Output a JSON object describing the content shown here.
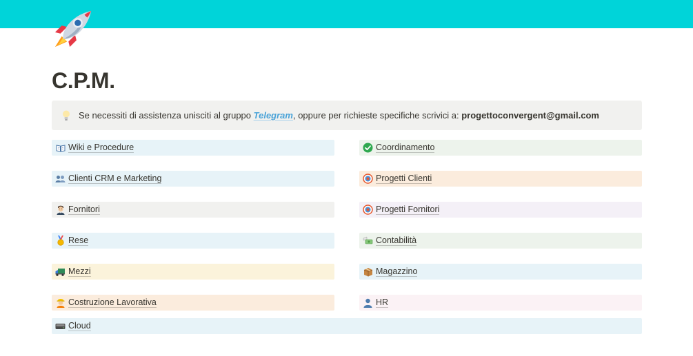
{
  "colors": {
    "cover": "#00d4d9",
    "callout_bg": "#f1f1ef",
    "link": "#4aa3d8",
    "blue_bg": "#e7f3f8",
    "green_bg": "#edf3ec",
    "orange_bg": "#fbecdd",
    "gray_bg": "#f1f1ef",
    "purple_bg": "#f4f0f7",
    "yellow_bg": "#fbf3db",
    "pink_bg": "#fbf2f5"
  },
  "page": {
    "icon": "rocket-icon",
    "title": "C.P.M."
  },
  "callout": {
    "icon": "lightbulb-icon",
    "text_before": "Se necessiti di assistenza unisciti al gruppo ",
    "link_text": "Telegram",
    "text_middle": ", oppure per richieste specifiche scrivici a: ",
    "email": "progettoconvergent@gmail.com"
  },
  "links": {
    "wiki": {
      "icon": "open-book-icon",
      "label": "Wiki e Procedure"
    },
    "coordinamento": {
      "icon": "green-check-icon",
      "label": "Coordinamento"
    },
    "clienti": {
      "icon": "people-icon",
      "label": "Clienti CRM e Marketing"
    },
    "progetti_clienti": {
      "icon": "target-icon",
      "label": "Progetti Clienti"
    },
    "fornitori": {
      "icon": "man-face-icon",
      "label": "Fornitori"
    },
    "progetti_fornitori": {
      "icon": "target-icon",
      "label": "Progetti Fornitori"
    },
    "rese": {
      "icon": "medal-icon",
      "label": "Rese"
    },
    "contabilita": {
      "icon": "money-wings-icon",
      "label": "Contabilità"
    },
    "mezzi": {
      "icon": "truck-icon",
      "label": "Mezzi"
    },
    "magazzino": {
      "icon": "package-icon",
      "label": "Magazzino"
    },
    "costruzione": {
      "icon": "construction-worker-icon",
      "label": "Costruzione Lavorativa"
    },
    "hr": {
      "icon": "person-silhouette-icon",
      "label": "HR"
    },
    "cloud": {
      "icon": "hard-drive-icon",
      "label": "Cloud"
    }
  }
}
